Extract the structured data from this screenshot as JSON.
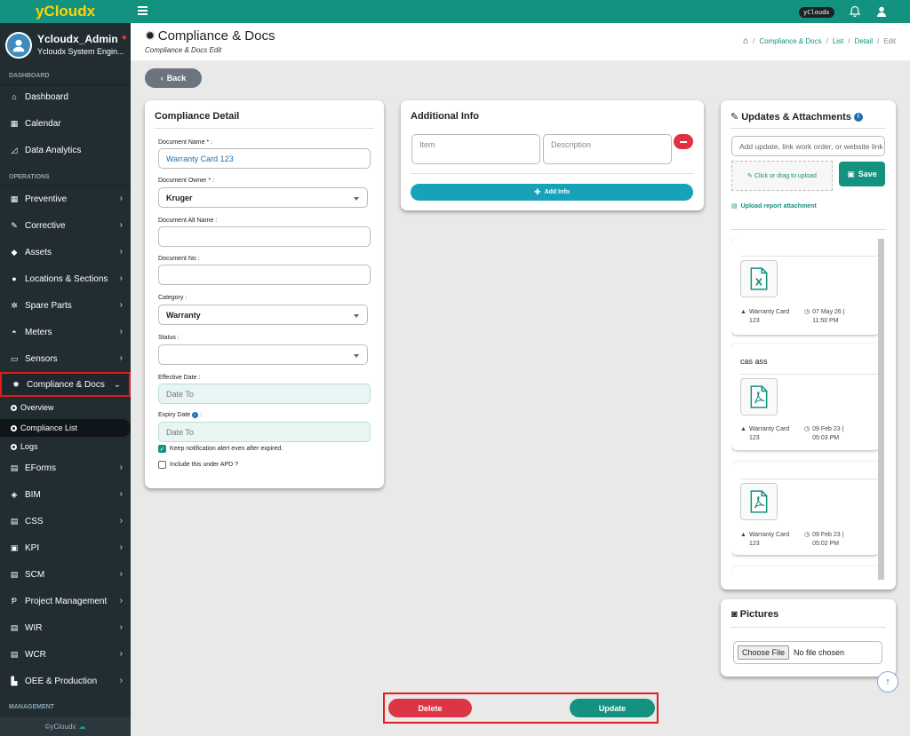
{
  "app": {
    "brand": "yCloudx",
    "footer": "©yCloudx",
    "top_badge": "yCloudx"
  },
  "user": {
    "name": "Ycloudx_Admin",
    "role": "Ycloudx System Engin..."
  },
  "sidebar": {
    "sections": {
      "dashboard": "DASHBOARD",
      "operations": "OPERATIONS",
      "management": "MANAGEMENT"
    },
    "items": {
      "dashboard": "Dashboard",
      "calendar": "Calendar",
      "analytics": "Data Analytics",
      "preventive": "Preventive",
      "corrective": "Corrective",
      "assets": "Assets",
      "locations": "Locations & Sections",
      "spare": "Spare Parts",
      "meters": "Meters",
      "sensors": "Sensors",
      "compliance": "Compliance & Docs",
      "eforms": "EForms",
      "bim": "BIM",
      "css": "CSS",
      "kpi": "KPI",
      "scm": "SCM",
      "pm": "Project Management",
      "wir": "WIR",
      "wcr": "WCR",
      "oee": "OEE & Production"
    },
    "sub": {
      "overview": "Overview",
      "list": "Compliance List",
      "logs": "Logs"
    }
  },
  "header": {
    "title": "Compliance & Docs",
    "subtitle": "Compliance & Docs Edit",
    "breadcrumb": {
      "c1": "Compliance & Docs",
      "c2": "List",
      "c3": "Detail",
      "c4": "Edit",
      "sep": "/"
    }
  },
  "back_label": "Back",
  "detail": {
    "title": "Compliance Detail",
    "name_label": "Document Name * :",
    "name_value": "Warranty Card 123",
    "owner_label": "Document Owner * :",
    "owner_value": "Kruger",
    "alt_label": "Document Alt Name :",
    "alt_value": "",
    "no_label": "Document No :",
    "no_value": "",
    "cat_label": "Category :",
    "cat_value": "Warranty",
    "status_label": "Status :",
    "status_value": "",
    "eff_label": "Effective Date :",
    "eff_placeholder": "Date To",
    "exp_label": "Expiry Date",
    "exp_placeholder": "Date To",
    "chk1": "Keep notification alert even after expired.",
    "chk2": "Include this under APD ?"
  },
  "additional": {
    "title": "Additional Info",
    "item_ph": "Item",
    "desc_ph": "Description",
    "add_label": "Add Info"
  },
  "updates": {
    "title": "Updates & Attachments",
    "input_ph": "Add update, link work order, or website link",
    "drop": "Click or drag to upload",
    "save": "Save",
    "upload_link": "Upload report attachment",
    "entries": [
      {
        "text": "",
        "file": "Warranty Card 123",
        "date": "07 May 26 | 11:50 PM"
      },
      {
        "text": "cas ass",
        "file": "Warranty Card 123",
        "date": "09 Feb 23 | 05:03 PM"
      },
      {
        "text": "",
        "file": "Warranty Card 123",
        "date": "09 Feb 23 | 05:02 PM"
      }
    ]
  },
  "pictures": {
    "title": "Pictures",
    "choose": "Choose File",
    "nofile": "No file chosen"
  },
  "actions": {
    "delete": "Delete",
    "update": "Update"
  },
  "colors": {
    "primary": "#13927f",
    "danger": "#dc3545",
    "info": "#17a2b8",
    "sidebar": "#222d32"
  }
}
